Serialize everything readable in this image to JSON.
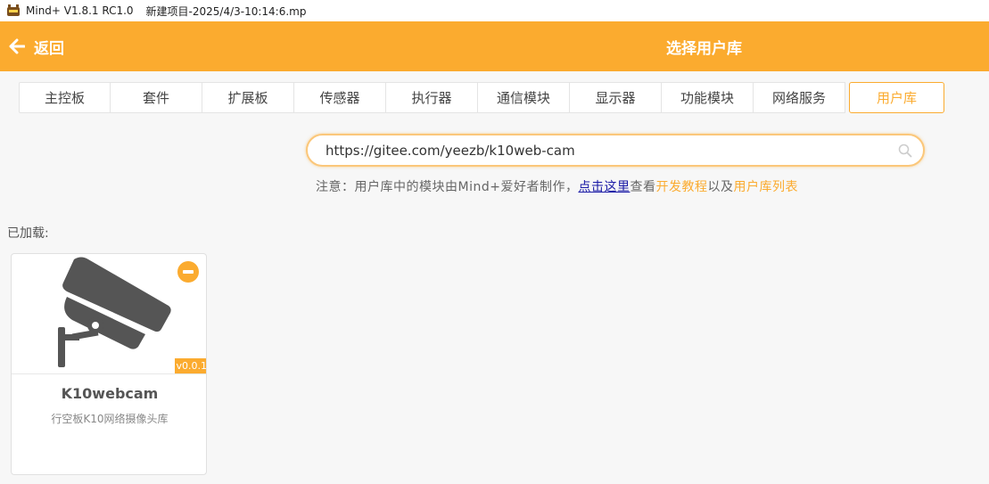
{
  "window": {
    "app_name": "Mind+ V1.8.1 RC1.0",
    "project": "新建项目-2025/4/3-10:14:6.mp"
  },
  "header": {
    "back_label": "返回",
    "title": "选择用户库"
  },
  "tabs": [
    {
      "label": "主控板",
      "active": false
    },
    {
      "label": "套件",
      "active": false
    },
    {
      "label": "扩展板",
      "active": false
    },
    {
      "label": "传感器",
      "active": false
    },
    {
      "label": "执行器",
      "active": false
    },
    {
      "label": "通信模块",
      "active": false
    },
    {
      "label": "显示器",
      "active": false
    },
    {
      "label": "功能模块",
      "active": false
    },
    {
      "label": "网络服务",
      "active": false
    },
    {
      "label": "用户库",
      "active": true
    }
  ],
  "search": {
    "value": "https://gitee.com/yeezb/k10web-cam",
    "placeholder": ""
  },
  "notice": {
    "prefix": "注意：用户库中的模块由Mind+爱好者制作，",
    "link": "点击这里",
    "mid": "查看",
    "tutorial": "开发教程",
    "and": "以及",
    "list": "用户库列表"
  },
  "loaded": {
    "label": "已加载:",
    "items": [
      {
        "name": "K10webcam",
        "description": "行空板K10网络摄像头库",
        "version": "v0.0.1"
      }
    ]
  },
  "colors": {
    "accent": "#fbab2f",
    "link": "#1a1aa6"
  }
}
